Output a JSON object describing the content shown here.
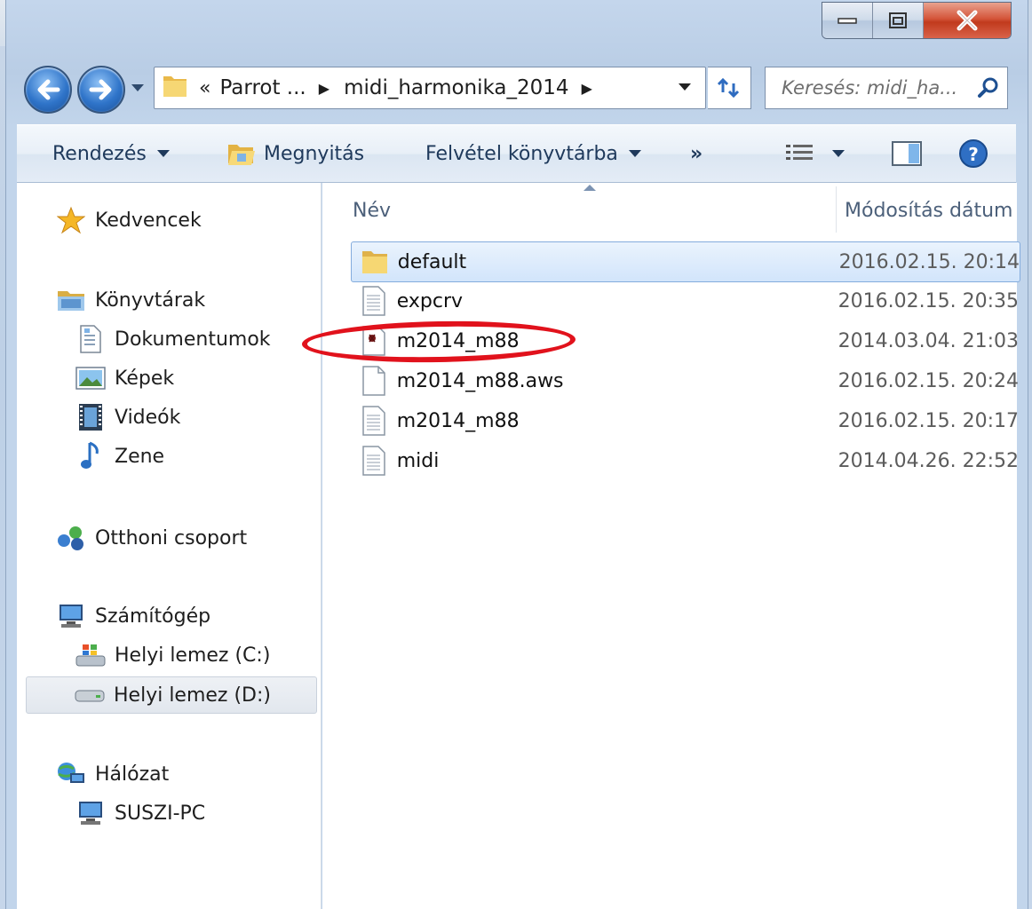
{
  "addressBar": {
    "chevron": "«",
    "crumbs": [
      "Parrot ...",
      "midi_harmonika_2014"
    ]
  },
  "search": {
    "placeholder": "Keresés: midi_ha..."
  },
  "toolbar": {
    "organize": "Rendezés",
    "open": "Megnyitás",
    "addToLibrary": "Felvétel könyvtárba",
    "more": "»"
  },
  "navPane": {
    "favorites": "Kedvencek",
    "libraries": "Könyvtárak",
    "documents": "Dokumentumok",
    "pictures": "Képek",
    "videos": "Videók",
    "music": "Zene",
    "homegroup": "Otthoni csoport",
    "computer": "Számítógép",
    "driveC": "Helyi lemez (C:)",
    "driveD": "Helyi lemez (D:)",
    "network": "Hálózat",
    "pc": "SUSZI-PC"
  },
  "fileList": {
    "columns": {
      "name": "Név",
      "modified": "Módosítás dátum"
    },
    "rows": [
      {
        "name": "default",
        "date": "2016.02.15. 20:14",
        "icon": "folder-icon"
      },
      {
        "name": "expcrv",
        "date": "2016.02.15. 20:35",
        "icon": "text-file-icon"
      },
      {
        "name": "m2014_m88",
        "date": "2014.03.04. 21:03",
        "icon": "audio-file-icon"
      },
      {
        "name": "m2014_m88.aws",
        "date": "2016.02.15. 20:24",
        "icon": "blank-file-icon"
      },
      {
        "name": "m2014_m88",
        "date": "2016.02.15. 20:17",
        "icon": "text-file-icon"
      },
      {
        "name": "midi",
        "date": "2014.04.26. 22:52",
        "icon": "text-file-icon"
      }
    ]
  },
  "colors": {
    "highlight": "#e1121c",
    "selection": "#d2e5fb",
    "accent": "#2f74c9"
  }
}
